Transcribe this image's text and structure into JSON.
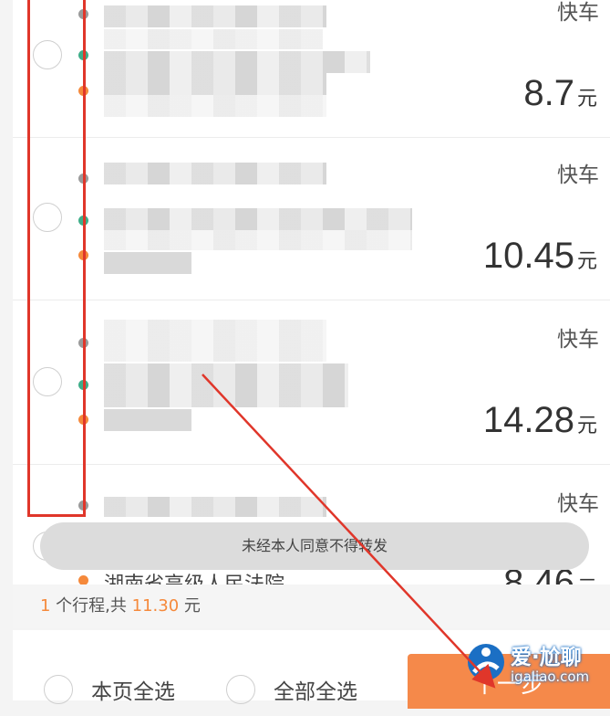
{
  "trips": [
    {
      "type": "快车",
      "price": "8.7",
      "unit": "元"
    },
    {
      "type": "快车",
      "price": "10.45",
      "unit": "元"
    },
    {
      "type": "快车",
      "price": "14.28",
      "unit": "元"
    },
    {
      "type": "快车",
      "price": "8.46",
      "unit": "元",
      "end_text": "湖南省高级人民法院"
    }
  ],
  "toast": "未经本人同意不得转发",
  "summary": {
    "count": "1",
    "count_suffix": " 个行程,共 ",
    "total": "11.30",
    "unit": " 元"
  },
  "footer": {
    "select_page": "本页全选",
    "select_all": "全部全选",
    "next": "下一步"
  },
  "watermark": {
    "title": "爱·尬聊",
    "url": "igaliao.com"
  },
  "colors": {
    "accent": "#f5893b",
    "annotation_red": "#e0362a",
    "dot_start": "#9a9a9a",
    "dot_mid": "#3fae89"
  }
}
